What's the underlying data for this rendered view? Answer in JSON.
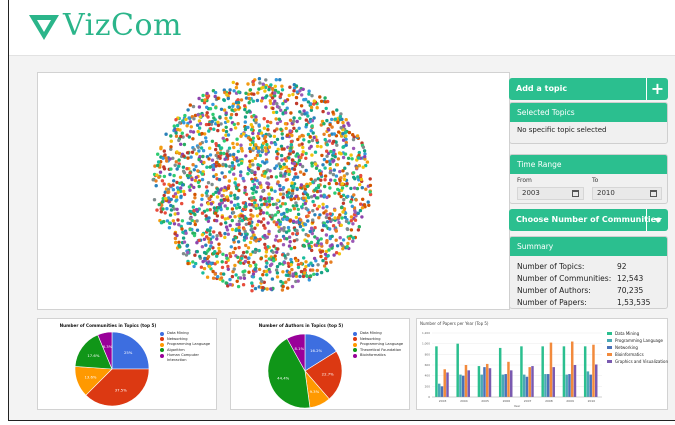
{
  "app": {
    "name": "VizCom",
    "brand_color": "#2bb58a"
  },
  "sidebar": {
    "add_topic_label": "Add a topic",
    "add_icon": "+",
    "selected_topics": {
      "title": "Selected Topics",
      "text": "No specific topic selected"
    },
    "time_range": {
      "title": "Time Range",
      "from_label": "From",
      "to_label": "To",
      "from_value": "2003",
      "to_value": "2010"
    },
    "communities_dropdown_label": "Choose Number of Communities",
    "summary": {
      "title": "Summary",
      "rows": [
        {
          "label": "Number of Topics:",
          "value": "92"
        },
        {
          "label": "Number of Communities:",
          "value": "12,543"
        },
        {
          "label": "Number of Authors:",
          "value": "70,235"
        },
        {
          "label": "Number of Papers:",
          "value": "1,53,535"
        }
      ]
    }
  },
  "chart_data": [
    {
      "type": "pie",
      "title": "Number of Communities in Topics (top 5)",
      "labels": [
        "Data Mining",
        "Networking",
        "Programming Language",
        "Algorithm",
        "Human Computer Interaction"
      ],
      "values": [
        25,
        37.5,
        13.6,
        17.6,
        6.3
      ],
      "value_labels": [
        "25%",
        "37.5%",
        "13.6%",
        "17.6%",
        "6.3%"
      ],
      "colors": [
        "#3d6ee0",
        "#dc3912",
        "#ff9900",
        "#109618",
        "#990099"
      ],
      "legend": "right"
    },
    {
      "type": "pie",
      "title": "Number of Authors in Topics (top 5)",
      "labels": [
        "Data Mining",
        "Networking",
        "Programming Language",
        "Theoretical Foundation",
        "Bioinformatics"
      ],
      "values": [
        16.2,
        22.7,
        9.3,
        44.4,
        8.1
      ],
      "value_labels": [
        "16.2%",
        "22.7%",
        "9.3%",
        "44.4%",
        "8.1%"
      ],
      "colors": [
        "#3d6ee0",
        "#dc3912",
        "#ff9900",
        "#109618",
        "#990099"
      ],
      "legend": "right"
    },
    {
      "type": "bar",
      "title": "Number of Papers per Year (Top 5)",
      "xlabel": "Year",
      "categories": [
        "2003",
        "2004",
        "2005",
        "2006",
        "2007",
        "2008",
        "2009",
        "2010"
      ],
      "ylim": [
        0,
        1200
      ],
      "series": [
        {
          "name": "Data Mining",
          "color": "#2bbf8f",
          "values": [
            950,
            1000,
            580,
            920,
            950,
            950,
            950,
            950
          ]
        },
        {
          "name": "Programming Language",
          "color": "#4aa8b5",
          "values": [
            250,
            420,
            420,
            420,
            420,
            430,
            420,
            480
          ]
        },
        {
          "name": "Networking",
          "color": "#4a72b8",
          "values": [
            200,
            400,
            560,
            430,
            380,
            430,
            430,
            420
          ]
        },
        {
          "name": "Bioinformatics",
          "color": "#f28a3c",
          "values": [
            520,
            600,
            620,
            660,
            560,
            1020,
            1040,
            980
          ]
        },
        {
          "name": "Graphics and Visualization",
          "color": "#7a5ab0",
          "values": [
            460,
            500,
            540,
            500,
            580,
            560,
            600,
            610
          ]
        }
      ],
      "legend": "right"
    }
  ]
}
